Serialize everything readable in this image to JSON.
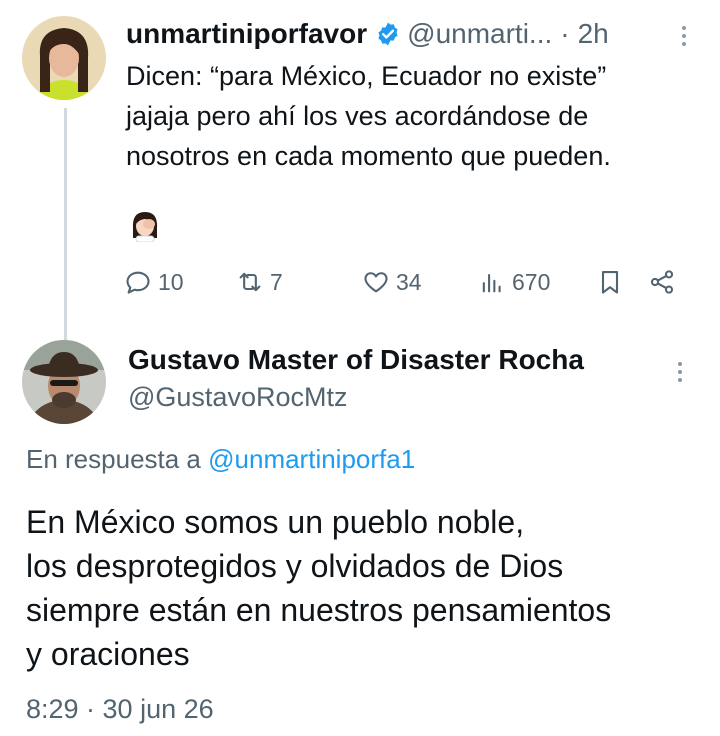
{
  "tweet1": {
    "display_name": "unmartiniporfavor",
    "handle": "@unmarti...",
    "time": "2h",
    "separator": "·",
    "body": {
      "line1": "Dicen: “para México, Ecuador no existe”",
      "line2": "jajaja pero ahí los ves acordándose de",
      "line3": "nosotros en cada momento que pueden."
    },
    "emoji": "woman-facepalming",
    "actions": {
      "replies": "10",
      "reposts": "7",
      "likes": "34",
      "views": "670"
    },
    "verified_color": "#1d9bf0"
  },
  "tweet2": {
    "display_name": "Gustavo Master of Disaster Rocha",
    "handle": "@GustavoRocMtz",
    "reply_prefix": "En respuesta a",
    "reply_mention": "@unmartiniporfa1",
    "body": {
      "line1": "En México somos un pueblo noble,",
      "line2": "los desprotegidos y olvidados de Dios",
      "line3": "siempre están en nuestros pensamientos",
      "line4": "y oraciones"
    },
    "timestamp": "8:29 · 30 jun 26"
  },
  "colors": {
    "accent": "#1d9bf0",
    "secondary_text": "#536471",
    "primary_text": "#0f1419"
  }
}
